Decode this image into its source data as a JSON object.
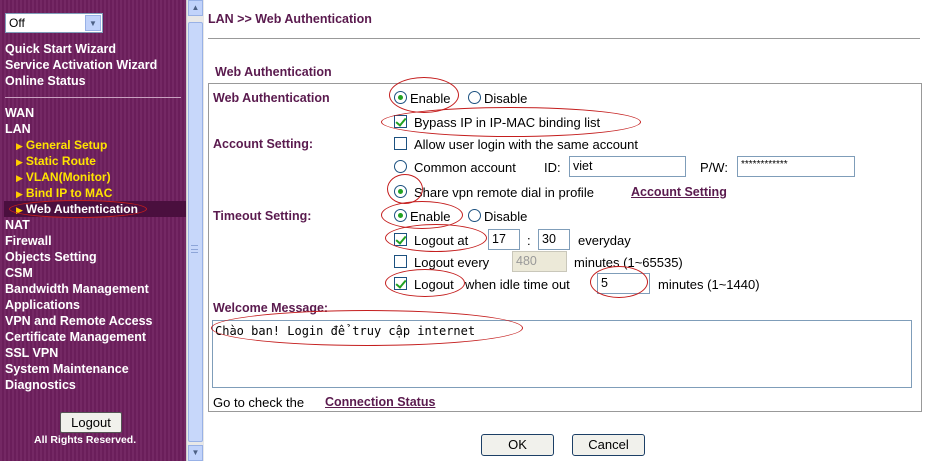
{
  "sidebar": {
    "mode_select": "Off",
    "top_items": [
      "Quick Start Wizard",
      "Service Activation Wizard",
      "Online Status"
    ],
    "wan": "WAN",
    "lan": "LAN",
    "lan_sub": [
      "General Setup",
      "Static Route",
      "VLAN(Monitor)",
      "Bind IP to MAC",
      "Web Authentication"
    ],
    "items": [
      "NAT",
      "Firewall",
      "Objects Setting",
      "CSM",
      "Bandwidth Management",
      "Applications",
      "VPN and Remote Access",
      "Certificate Management",
      "SSL VPN",
      "System Maintenance",
      "Diagnostics"
    ],
    "logout": "Logout",
    "rights": "All Rights Reserved."
  },
  "main": {
    "breadcrumb": "LAN >> Web Authentication",
    "panel_title": "Web Authentication",
    "web_auth": {
      "label": "Web Authentication",
      "enable": "Enable",
      "disable": "Disable",
      "bypass": "Bypass IP in IP-MAC binding list"
    },
    "account": {
      "label": "Account Setting:",
      "allow_same": "Allow user login with the same account",
      "common": "Common account",
      "id_label": "ID:",
      "id_value": "viet",
      "pw_label": "P/W:",
      "pw_value": "************",
      "share_vpn": "Share vpn remote dial in profile",
      "account_link": "Account Setting"
    },
    "timeout": {
      "label": "Timeout Setting:",
      "enable": "Enable",
      "disable": "Disable",
      "logout_at": "Logout at",
      "hour": "17",
      "colon": ":",
      "minute": "30",
      "everyday": "everyday",
      "logout_every": "Logout every",
      "every_value": "480",
      "every_unit": "minutes (1~65535)",
      "logout_idle": "Logout",
      "idle_text": "when idle time out",
      "idle_value": "5",
      "idle_unit": "minutes (1~1440)"
    },
    "welcome": {
      "label": "Welcome Message:",
      "message": "Chào ban! Login để truy cập internet"
    },
    "footer": {
      "prefix": "Go to check the",
      "link": "Connection Status"
    },
    "ok": "OK",
    "cancel": "Cancel"
  }
}
